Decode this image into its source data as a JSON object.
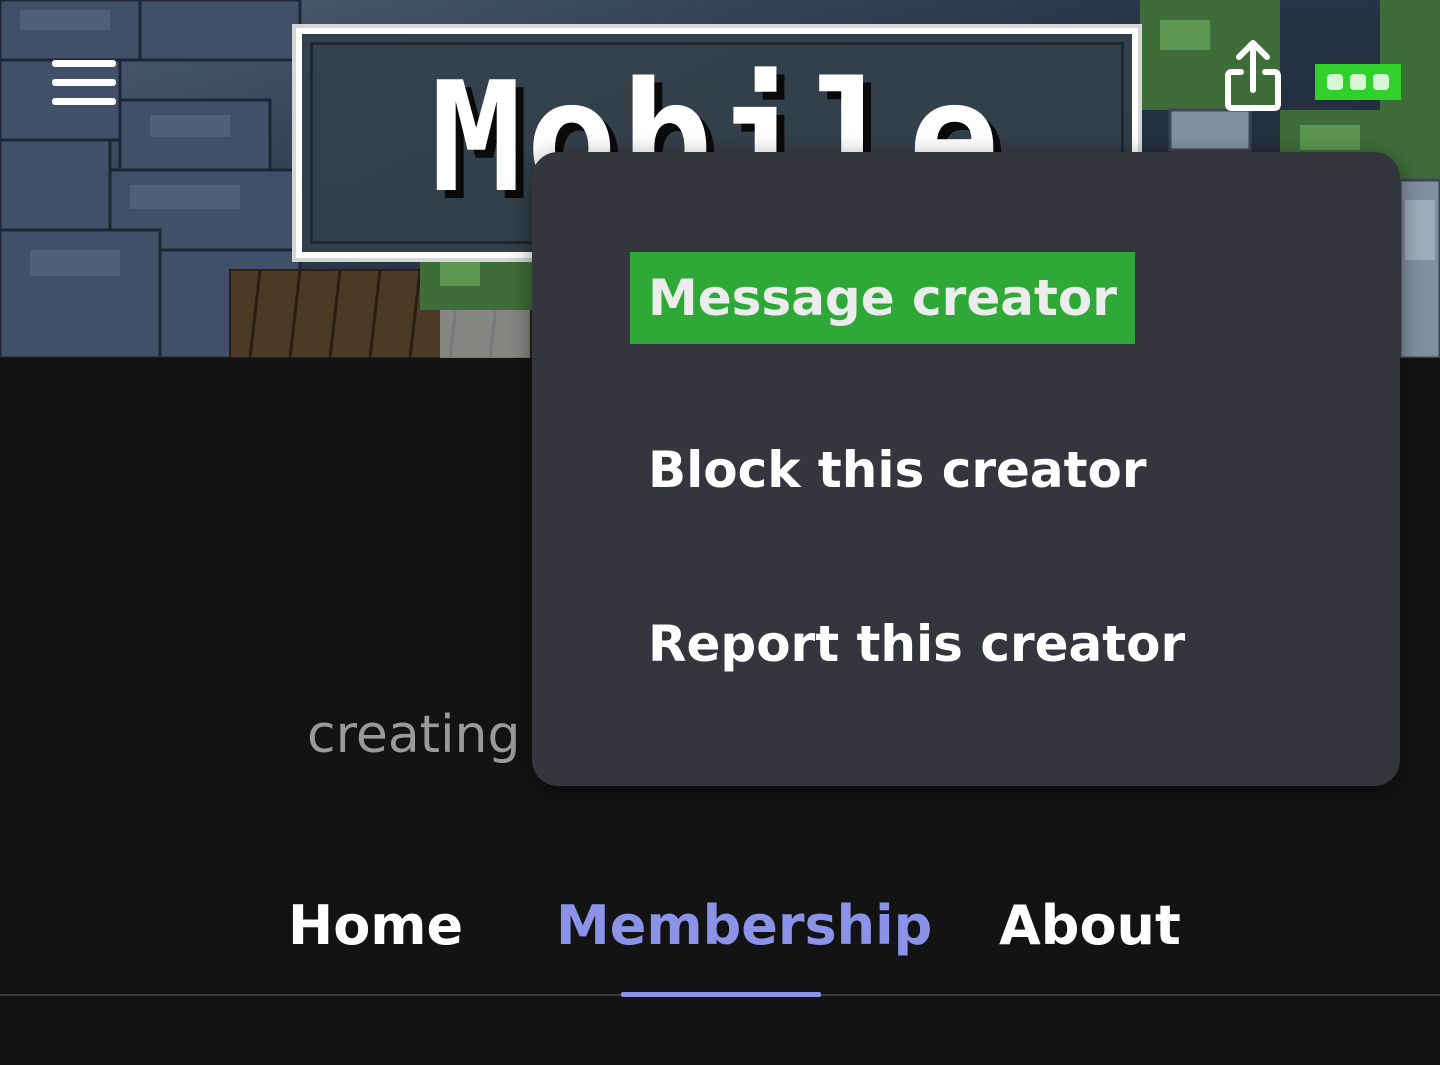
{
  "header": {
    "logo_text": "Mobile",
    "menu_icon": "hamburger-menu-icon",
    "share_icon": "share-upload-icon",
    "more_icon": "more-dots-icon",
    "accent_color": "#2fd12a"
  },
  "dropdown": {
    "items": [
      {
        "label": "Message creator",
        "highlighted": true
      },
      {
        "label": "Block this creator",
        "highlighted": false
      },
      {
        "label": "Report this creator",
        "highlighted": false
      }
    ],
    "highlight_color": "#2ea836",
    "background_color": "#34353d"
  },
  "profile": {
    "bio_partial": "creating"
  },
  "tabs": {
    "items": [
      {
        "label": "Home",
        "active": false
      },
      {
        "label": "Membership",
        "active": true
      },
      {
        "label": "About",
        "active": false
      }
    ],
    "active_color": "#8b93e8"
  }
}
